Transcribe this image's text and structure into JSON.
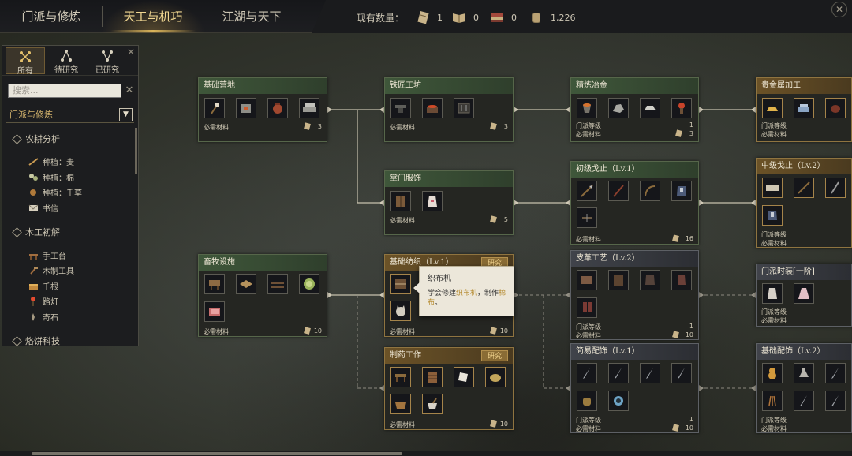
{
  "tabs": [
    {
      "label": "门派与修炼"
    },
    {
      "label": "天工与机巧"
    },
    {
      "label": "江湖与天下"
    }
  ],
  "stock": {
    "label": "现有数量：",
    "items": [
      {
        "icon": "scroll-icon",
        "value": "1"
      },
      {
        "icon": "book-icon",
        "value": "0"
      },
      {
        "icon": "books-stack-icon",
        "value": "0"
      },
      {
        "icon": "coin-pouch-icon",
        "value": "1,226"
      }
    ]
  },
  "filter": {
    "tabs": [
      {
        "label": "所有",
        "icon": "all-icon"
      },
      {
        "label": "待研究",
        "icon": "pending-icon"
      },
      {
        "label": "已研究",
        "icon": "done-icon"
      }
    ],
    "search_placeholder": "搜索...",
    "category": "门派与修炼",
    "groups": [
      {
        "title": "农耕分析",
        "items": [
          "种植：麦",
          "种植：棉",
          "种植：千草",
          "书信"
        ]
      },
      {
        "title": "木工初解",
        "items": [
          "手工台",
          "木制工具",
          "千根",
          "路灯",
          "奇石"
        ]
      },
      {
        "title": "烙饼科技",
        "items": []
      }
    ]
  },
  "cards": {
    "c1": {
      "title": "基础营地",
      "req": "必需材料",
      "cost": "3"
    },
    "c2": {
      "title": "铁匠工坊",
      "req": "必需材料",
      "cost": "3"
    },
    "c3": {
      "title": "精炼冶金",
      "req1": "门派等级",
      "req2": "必需材料",
      "lvl": "1",
      "cost": "3"
    },
    "c4": {
      "title": "贵金属加工",
      "req1": "门派等级",
      "req2": "必需材料"
    },
    "c5": {
      "title": "掌门服饰",
      "req": "必需材料",
      "cost": "5"
    },
    "c6": {
      "title": "初级戈止（Lv.1）",
      "req": "必需材料",
      "cost": "16"
    },
    "c7": {
      "title": "中级戈止（Lv.2）",
      "req1": "门派等级",
      "req2": "必需材料"
    },
    "c8": {
      "title": "畜牧设施",
      "req": "必需材料",
      "cost": "10"
    },
    "c9": {
      "title": "基础纺织（Lv.1）",
      "badge": "研究",
      "req": "必需材料",
      "cost": "10"
    },
    "c10": {
      "title": "皮革工艺（Lv.2）",
      "req1": "门派等级",
      "req2": "必需材料",
      "lvl": "1",
      "cost": "10"
    },
    "c11": {
      "title": "门派时装[一阶]",
      "req1": "门派等级",
      "req2": "必需材料"
    },
    "c12": {
      "title": "制药工作",
      "badge": "研究",
      "req": "必需材料",
      "cost": "10"
    },
    "c13": {
      "title": "简易配饰（Lv.1）",
      "req1": "门派等级",
      "req2": "必需材料",
      "lvl": "1",
      "cost": "10"
    },
    "c14": {
      "title": "基础配饰（Lv.2）",
      "req1": "门派等级",
      "req2": "必需材料"
    }
  },
  "tooltip": {
    "title": "织布机",
    "body_pre": "学会修建",
    "body_hl": "织布机",
    "body_mid": "，制作",
    "body_hl2": "棉布",
    "body_post": "。"
  },
  "colors": {
    "accent": "#d9b45a",
    "researched": "#56664a",
    "researching": "#8f7440",
    "locked": "#5d6065"
  }
}
